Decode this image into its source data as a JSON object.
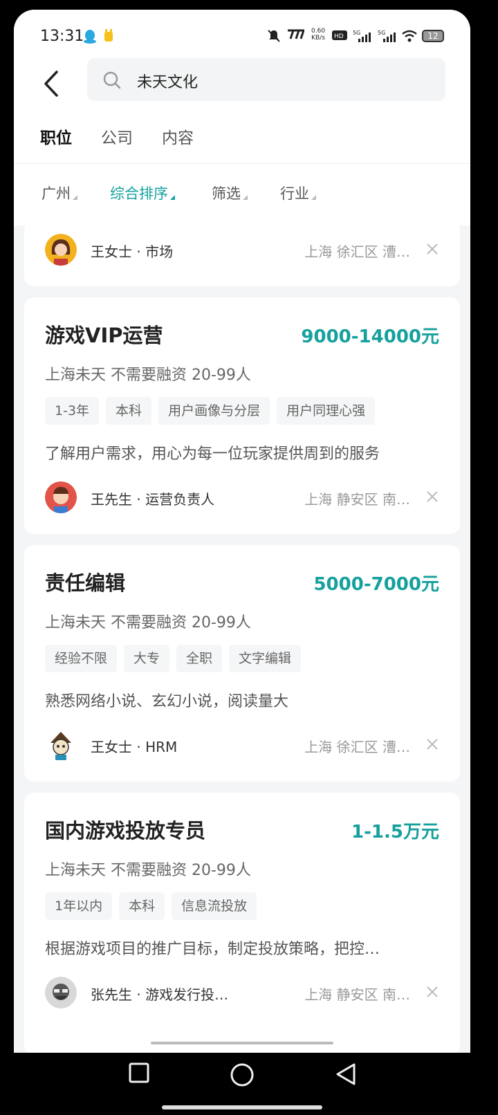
{
  "status_bar": {
    "time": "13:31",
    "net_speed": "0.60",
    "net_unit": "KB/s",
    "battery": "12"
  },
  "search": {
    "query": "未天文化"
  },
  "tabs": [
    {
      "label": "职位"
    },
    {
      "label": "公司"
    },
    {
      "label": "内容"
    }
  ],
  "filters": [
    {
      "label": "广州"
    },
    {
      "label": "综合排序"
    },
    {
      "label": "筛选"
    },
    {
      "label": "行业"
    }
  ],
  "accent_color": "#16a09d",
  "cards": [
    {
      "contact": {
        "name": "王女士",
        "role": "市场",
        "separator": "·"
      },
      "location": "上海  徐汇区  漕…"
    },
    {
      "title": "游戏VIP运营",
      "salary": "9000-14000元",
      "company": "上海未天  不需要融资  20-99人",
      "tags": [
        "1-3年",
        "本科",
        "用户画像与分层",
        "用户同理心强"
      ],
      "desc": "了解用户需求，用心为每一位玩家提供周到的服务",
      "contact": {
        "name": "王先生",
        "role": "运营负责人",
        "separator": "·"
      },
      "location": "上海  静安区  南…"
    },
    {
      "title": "责任编辑",
      "salary": "5000-7000元",
      "company": "上海未天  不需要融资  20-99人",
      "tags": [
        "经验不限",
        "大专",
        "全职",
        "文字编辑"
      ],
      "desc": "熟悉网络小说、玄幻小说，阅读量大",
      "contact": {
        "name": "王女士",
        "role": "HRM",
        "separator": "·"
      },
      "location": "上海  徐汇区  漕…"
    },
    {
      "title": "国内游戏投放专员",
      "salary": "1-1.5万元",
      "company": "上海未天  不需要融资  20-99人",
      "tags": [
        "1年以内",
        "本科",
        "信息流投放"
      ],
      "desc": "根据游戏项目的推广目标，制定投放策略，把控…",
      "contact": {
        "name": "张先生",
        "role": "游戏发行投…",
        "separator": "·"
      },
      "location": "上海  静安区  南…"
    }
  ]
}
